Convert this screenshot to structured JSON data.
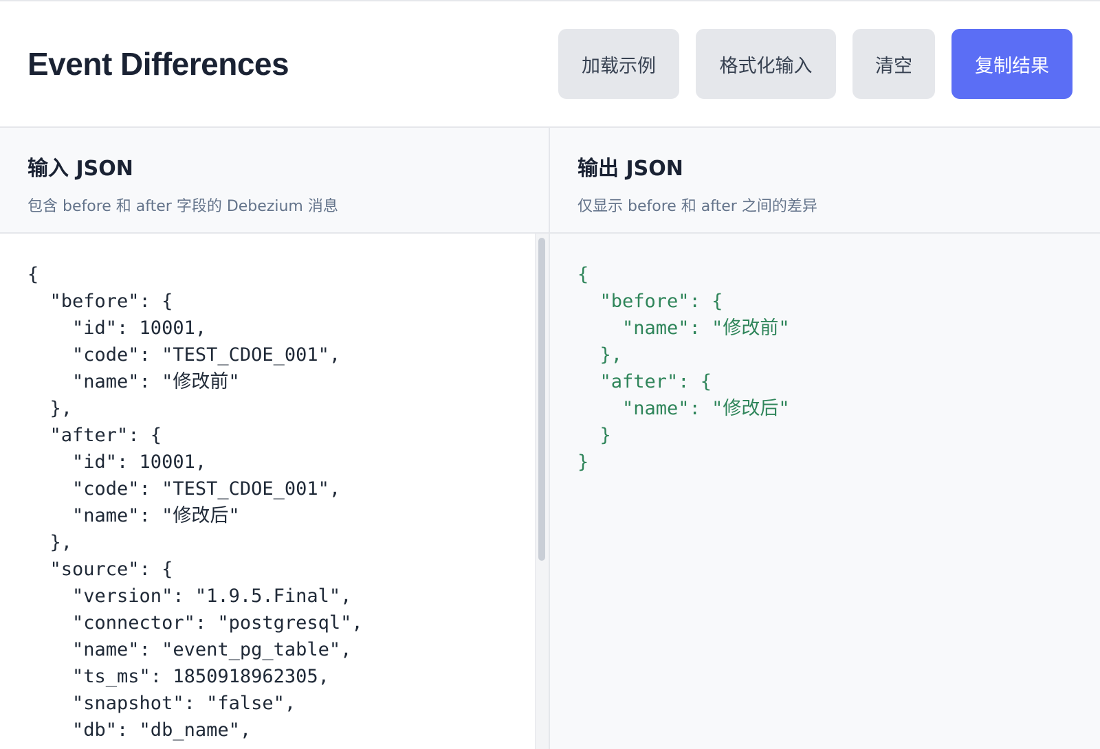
{
  "header": {
    "title": "Event Differences",
    "buttons": {
      "load_example": "加载示例",
      "format_input": "格式化输入",
      "clear": "清空",
      "copy_result": "复制结果"
    }
  },
  "input_pane": {
    "title": "输入 JSON",
    "subtitle": "包含 before 和 after 字段的 Debezium 消息",
    "content": "{\n  \"before\": {\n    \"id\": 10001,\n    \"code\": \"TEST_CDOE_001\",\n    \"name\": \"修改前\"\n  },\n  \"after\": {\n    \"id\": 10001,\n    \"code\": \"TEST_CDOE_001\",\n    \"name\": \"修改后\"\n  },\n  \"source\": {\n    \"version\": \"1.9.5.Final\",\n    \"connector\": \"postgresql\",\n    \"name\": \"event_pg_table\",\n    \"ts_ms\": 1850918962305,\n    \"snapshot\": \"false\",\n    \"db\": \"db_name\","
  },
  "output_pane": {
    "title": "输出 JSON",
    "subtitle": "仅显示 before 和 after 之间的差异",
    "content": "{\n  \"before\": {\n    \"name\": \"修改前\"\n  },\n  \"after\": {\n    \"name\": \"修改后\"\n  }\n}"
  },
  "colors": {
    "primary": "#5b6ef5",
    "secondary_button": "#e5e7eb",
    "output_text": "#2f855a",
    "pane_header_bg": "#f8f9fb"
  }
}
